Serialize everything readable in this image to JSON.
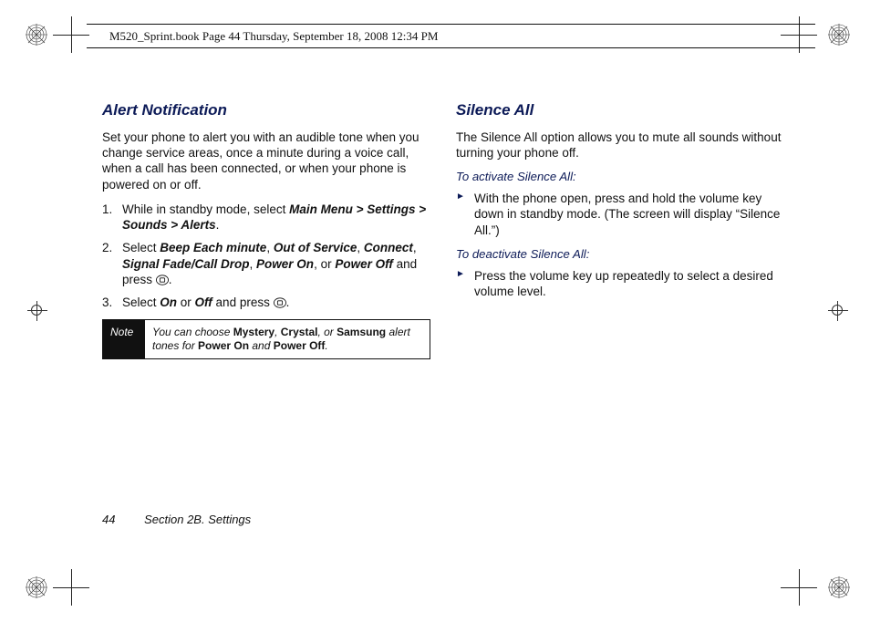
{
  "header": {
    "runhead": "M520_Sprint.book  Page 44  Thursday, September 18, 2008  12:34 PM"
  },
  "left": {
    "heading": "Alert Notification",
    "intro": "Set your phone to alert you with an audible tone when you change service areas, once a minute during a voice call, when a call has been connected, or when your phone is powered on or off.",
    "step1_pre": "While in standby mode, select ",
    "step1_path": "Main Menu > Settings > Sounds > Alerts",
    "step1_post": ".",
    "step2_pre": "Select ",
    "step2_opts": {
      "a": "Beep Each minute",
      "b": "Out of Service",
      "c": "Connect",
      "d": "Signal Fade/Call Drop",
      "e": "Power On",
      "f": "Power Off"
    },
    "step2_or": ", or ",
    "step2_and": " and press ",
    "step3_pre": "Select ",
    "step3_on": "On",
    "step3_or": " or ",
    "step3_off": "Off",
    "step3_post": " and press ",
    "note_label": "Note",
    "note_pre": "You can choose ",
    "note_m": "Mystery",
    "note_c": "Crystal",
    "note_or": ", or ",
    "note_s": "Samsung",
    "note_mid": " alert tones for ",
    "note_pon": "Power On",
    "note_and": " and ",
    "note_poff": "Power Off",
    "note_end": "."
  },
  "right": {
    "heading": "Silence All",
    "intro": "The Silence All option allows you to mute all sounds without turning your phone off.",
    "sub1": "To activate Silence All:",
    "b1": "With the phone open, press and hold the volume key down in standby mode. (The screen will display “Silence All.”)",
    "sub2": "To deactivate Silence All:",
    "b2": "Press the volume key up repeatedly to select a desired volume level."
  },
  "footer": {
    "page": "44",
    "section": "Section 2B. Settings"
  }
}
